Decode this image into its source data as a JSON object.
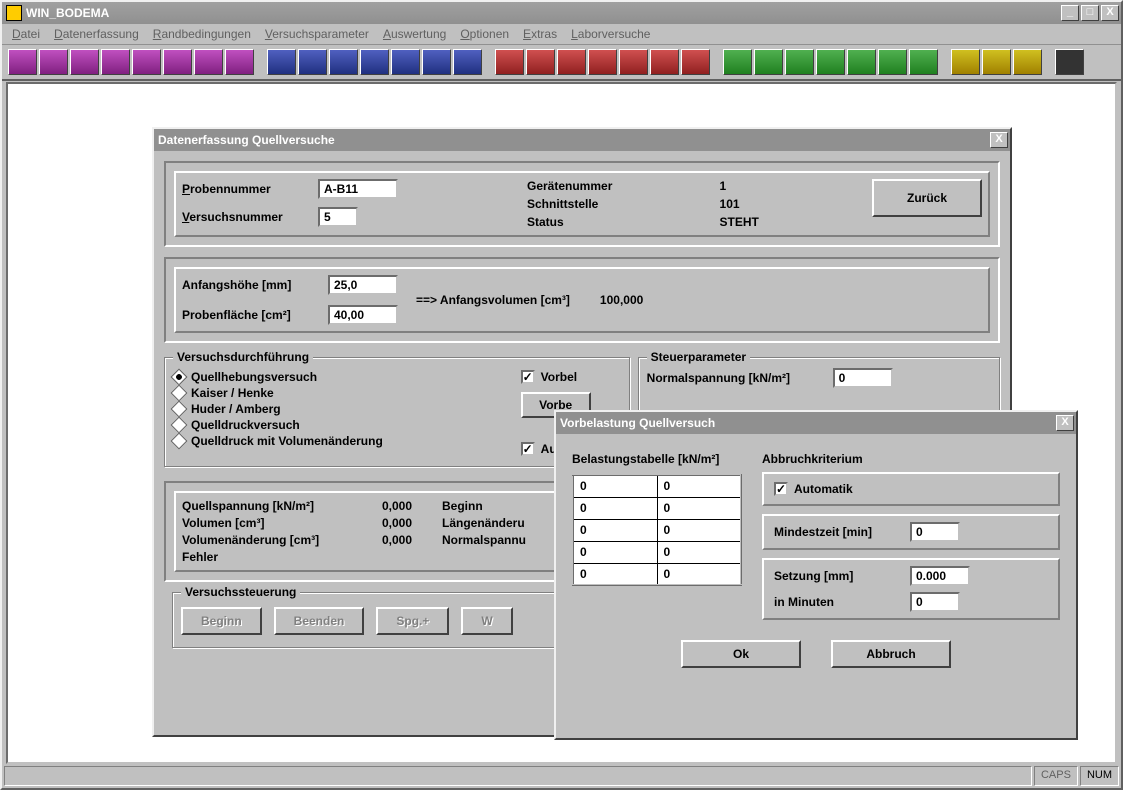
{
  "app": {
    "title": "WIN_BODEMA"
  },
  "menu": {
    "items": [
      "Datei",
      "Datenerfassung",
      "Randbedingungen",
      "Versuchsparameter",
      "Auswertung",
      "Optionen",
      "Extras",
      "Laborversuche"
    ]
  },
  "status": {
    "caps": "CAPS",
    "num": "NUM"
  },
  "dialogA": {
    "title": "Datenerfassung Quellversuche",
    "probennummer_label": "Probennummer",
    "probennummer": "A-B11",
    "versuchsnummer_label": "Versuchsnummer",
    "versuchsnummer": "5",
    "geraetenummer_label": "Gerätenummer",
    "geraetenummer": "1",
    "schnittstelle_label": "Schnittstelle",
    "schnittstelle": "101",
    "status_label": "Status",
    "status": "STEHT",
    "zurueck": "Zurück",
    "anfangshoehe_label": "Anfangshöhe [mm]",
    "anfangshoehe": "25,0",
    "probenflaeche_label": "Probenfläche [cm²]",
    "probenflaeche": "40,00",
    "anfangsvolumen_label": "==>  Anfangsvolumen [cm³]",
    "anfangsvolumen": "100,000",
    "versuchsdurchfuehrung_title": "Versuchsdurchführung",
    "radios": [
      "Quellhebungsversuch",
      "Kaiser / Henke",
      "Huder / Amberg",
      "Quelldruckversuch",
      "Quelldruck mit Volumenänderung"
    ],
    "vorbelastung_chk": "Vorbel",
    "vorbelastung_btn": "Vorbe",
    "automatik_chk": "Autom",
    "steuerparameter_title": "Steuerparameter",
    "normalspannung_label": "Normalspannung [kN/m²]",
    "normalspannung": "0",
    "readouts": {
      "quellspannung_label": "Quellspannung [kN/m²]",
      "quellspannung": "0,000",
      "quellspannung_r": "Beginn",
      "volumen_label": "Volumen [cm³]",
      "volumen": "0,000",
      "volumen_r": "Längenänderu",
      "volaenderung_label": "Volumenänderung [cm³]",
      "volaenderung": "0,000",
      "volaenderung_r": "Normalspannu",
      "fehler_label": "Fehler"
    },
    "steuerung_title": "Versuchssteuerung",
    "steuerung_buttons": [
      "Beginn",
      "Beenden",
      "Spg.+",
      "W"
    ]
  },
  "dialogB": {
    "title": "Vorbelastung Quellversuch",
    "belastung_title": "Belastungstabelle [kN/m²]",
    "table": [
      [
        "0",
        "0"
      ],
      [
        "0",
        "0"
      ],
      [
        "0",
        "0"
      ],
      [
        "0",
        "0"
      ],
      [
        "0",
        "0"
      ]
    ],
    "abbruch_title": "Abbruchkriterium",
    "automatik": "Automatik",
    "mindestzeit_label": "Mindestzeit [min]",
    "mindestzeit": "0",
    "setzung_label": "Setzung [mm]",
    "setzung": "0.000",
    "inminuten_label": "in Minuten",
    "inminuten": "0",
    "ok": "Ok",
    "abbruch": "Abbruch"
  }
}
